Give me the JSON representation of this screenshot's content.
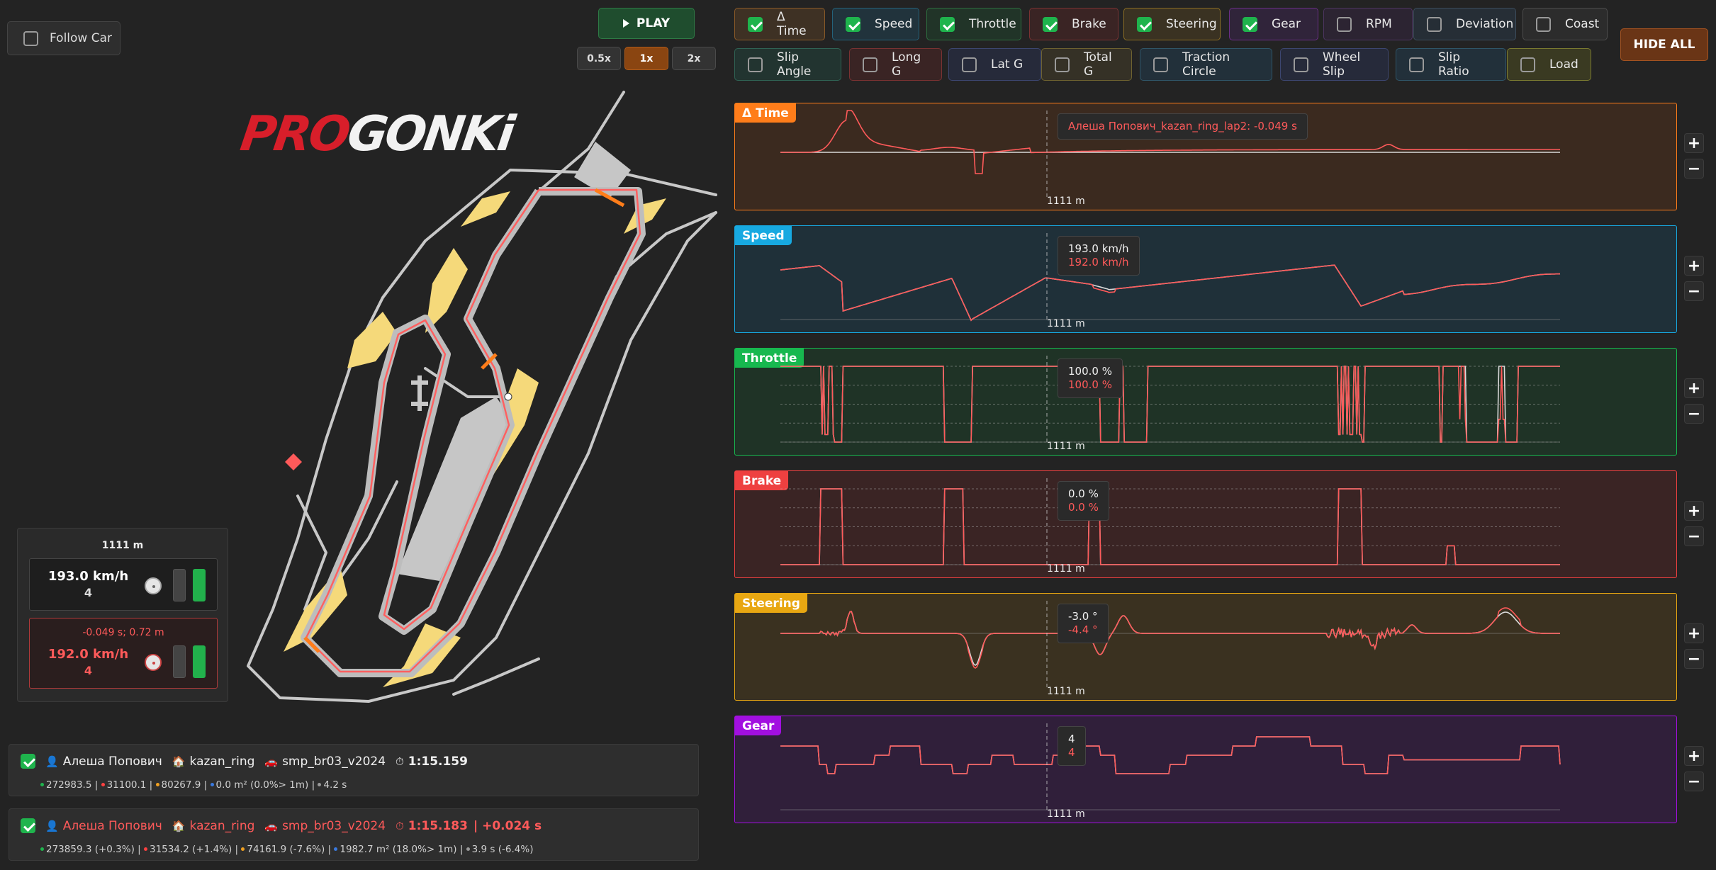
{
  "follow_car": {
    "label": "Follow Car",
    "checked": false
  },
  "play": {
    "label": "PLAY",
    "icon": "play-icon"
  },
  "speeds": [
    {
      "label": "0.5x",
      "active": false
    },
    {
      "label": "1x",
      "active": true
    },
    {
      "label": "2x",
      "active": false
    }
  ],
  "hide_all": "HIDE ALL",
  "logo": "PROGONKi",
  "toggles": [
    {
      "label": "Δ Time",
      "checked": true
    },
    {
      "label": "Speed",
      "checked": true
    },
    {
      "label": "Throttle",
      "checked": true
    },
    {
      "label": "Brake",
      "checked": true
    },
    {
      "label": "Steering",
      "checked": true
    },
    {
      "label": "Gear",
      "checked": true
    },
    {
      "label": "RPM",
      "checked": false
    },
    {
      "label": "Deviation",
      "checked": false
    },
    {
      "label": "Coast",
      "checked": false
    },
    {
      "label": "Slip Angle",
      "checked": false
    },
    {
      "label": "Long G",
      "checked": false
    },
    {
      "label": "Lat G",
      "checked": false
    },
    {
      "label": "Total G",
      "checked": false
    },
    {
      "label": "Traction Circle",
      "checked": false
    },
    {
      "label": "Wheel Slip",
      "checked": false
    },
    {
      "label": "Slip Ratio",
      "checked": false
    },
    {
      "label": "Load",
      "checked": false
    }
  ],
  "panels": [
    {
      "title": "Δ Time",
      "distance": "1111 m",
      "tip1": "Алеша Попович_kazan_ring_lap2: -0.049 s",
      "tip2": ""
    },
    {
      "title": "Speed",
      "distance": "1111 m",
      "tip1": "193.0 km/h",
      "tip2": "192.0 km/h"
    },
    {
      "title": "Throttle",
      "distance": "1111 m",
      "tip1": "100.0 %",
      "tip2": "100.0 %"
    },
    {
      "title": "Brake",
      "distance": "1111 m",
      "tip1": "0.0 %",
      "tip2": "0.0 %"
    },
    {
      "title": "Steering",
      "distance": "1111 m",
      "tip1": "-3.0 °",
      "tip2": "-4.4 °"
    },
    {
      "title": "Gear",
      "distance": "1111 m",
      "tip1": "4",
      "tip2": "4"
    }
  ],
  "info": {
    "distance": "1111 m",
    "car1": {
      "speed": "193.0 km/h",
      "gear": "4"
    },
    "car2": {
      "delta": "-0.049 s; 0.72 m",
      "speed": "192.0 km/h",
      "gear": "4"
    }
  },
  "laps": [
    {
      "checked": true,
      "driver": "Алеша Попович",
      "track": "kazan_ring",
      "car": "smp_br03_v2024",
      "time": "1:15.159",
      "delta": "",
      "stats": [
        "272983.5",
        "31100.1",
        "80267.9",
        "0.0 m² (0.0%> 1m)",
        "4.2 s"
      ]
    },
    {
      "checked": true,
      "driver": "Алеша Попович",
      "track": "kazan_ring",
      "car": "smp_br03_v2024",
      "time": "1:15.183",
      "delta": "| +0.024 s",
      "stats": [
        "273859.3 (+0.3%)",
        "31534.2 (+1.4%)",
        "74161.9 (-7.6%)",
        "1982.7 m² (18.0%> 1m)",
        "3.9 s (-6.4%)"
      ]
    }
  ],
  "colors": {
    "ref": "#d9d9d9",
    "cmp": "#ff5a5a",
    "green": "#1fb44d",
    "delta": "#ff7d1a",
    "speed": "#17a9e1",
    "throttle": "#17b84f",
    "brake": "#ee4040",
    "steering": "#e8a712",
    "gear": "#a20fe0"
  }
}
